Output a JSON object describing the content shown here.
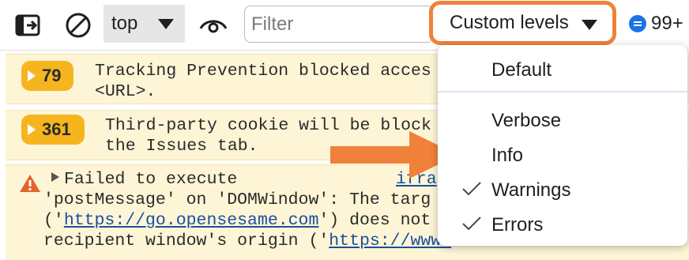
{
  "toolbar": {
    "sidebar_toggle_icon": "sidebar-toggle-icon",
    "clear_icon": "clear-console-icon",
    "context": "top",
    "eye_icon": "live-expression-icon",
    "filter_placeholder": "Filter",
    "levels_label": "Custom levels",
    "issues_count": "99+"
  },
  "messages": [
    {
      "count": "79",
      "lines": [
        "Tracking Prevention blocked acces",
        "<URL>."
      ]
    },
    {
      "count": "361",
      "lines": [
        "Third-party cookie will be block",
        "the Issues tab."
      ]
    },
    {
      "line1": "Failed to execute",
      "source": "ifra",
      "line2": "'postMessage' on 'DOMWindow': The targ",
      "line3_pre": "('",
      "line3_link": "https://go.opensesame.com",
      "line3_post": "') does not",
      "line4_pre": "recipient window's origin ('",
      "line4_link": "https://www."
    }
  ],
  "levels_menu": {
    "items": [
      {
        "label": "Default",
        "checked": false
      },
      {
        "label": "Verbose",
        "checked": false
      },
      {
        "label": "Info",
        "checked": false
      },
      {
        "label": "Warnings",
        "checked": true
      },
      {
        "label": "Errors",
        "checked": true
      }
    ]
  },
  "colors": {
    "highlight": "#f0813a",
    "warning_bg": "#fdf5d6",
    "badge": "#f6b51f",
    "link": "#1a4fa0"
  }
}
